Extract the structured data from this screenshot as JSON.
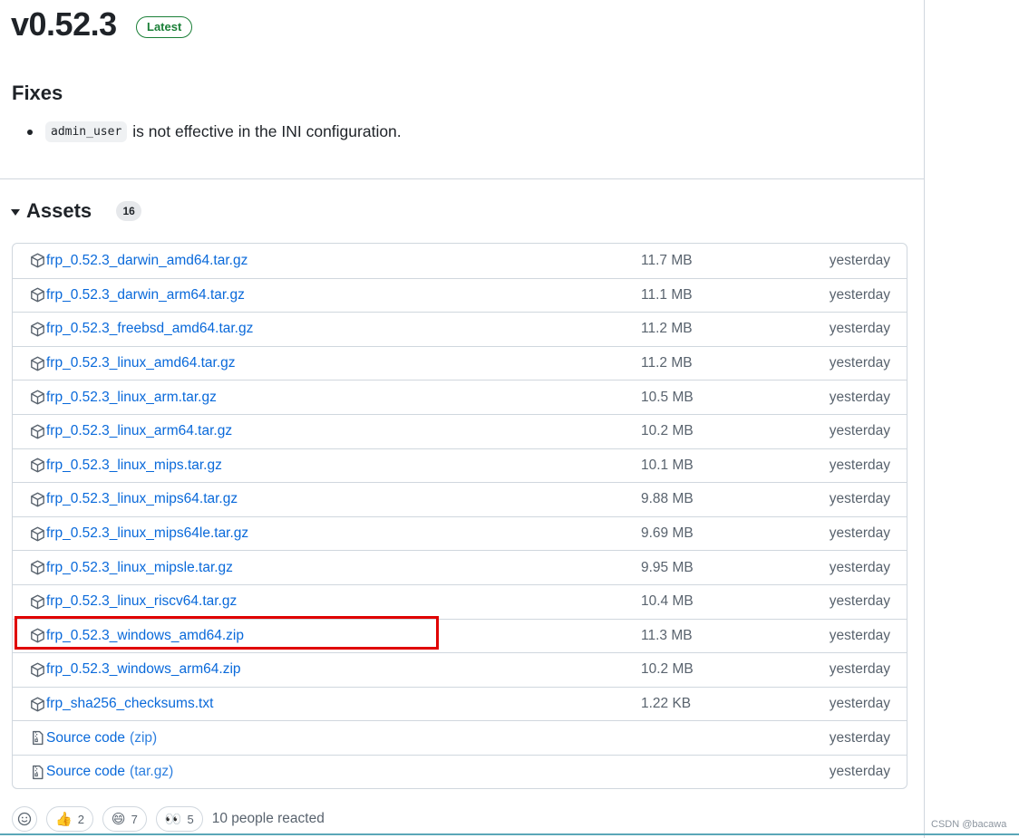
{
  "release": {
    "version": "v0.52.3",
    "badge": "Latest",
    "fixes_heading": "Fixes",
    "fix_code": "admin_user",
    "fix_text": "is not effective in the INI configuration."
  },
  "assets": {
    "title": "Assets",
    "count": "16",
    "rows": [
      {
        "name": "frp_0.52.3_darwin_amd64.tar.gz",
        "suffix": "",
        "size": "11.7 MB",
        "date": "yesterday",
        "icon": "package-icon"
      },
      {
        "name": "frp_0.52.3_darwin_arm64.tar.gz",
        "suffix": "",
        "size": "11.1 MB",
        "date": "yesterday",
        "icon": "package-icon"
      },
      {
        "name": "frp_0.52.3_freebsd_amd64.tar.gz",
        "suffix": "",
        "size": "11.2 MB",
        "date": "yesterday",
        "icon": "package-icon"
      },
      {
        "name": "frp_0.52.3_linux_amd64.tar.gz",
        "suffix": "",
        "size": "11.2 MB",
        "date": "yesterday",
        "icon": "package-icon"
      },
      {
        "name": "frp_0.52.3_linux_arm.tar.gz",
        "suffix": "",
        "size": "10.5 MB",
        "date": "yesterday",
        "icon": "package-icon"
      },
      {
        "name": "frp_0.52.3_linux_arm64.tar.gz",
        "suffix": "",
        "size": "10.2 MB",
        "date": "yesterday",
        "icon": "package-icon"
      },
      {
        "name": "frp_0.52.3_linux_mips.tar.gz",
        "suffix": "",
        "size": "10.1 MB",
        "date": "yesterday",
        "icon": "package-icon"
      },
      {
        "name": "frp_0.52.3_linux_mips64.tar.gz",
        "suffix": "",
        "size": "9.88 MB",
        "date": "yesterday",
        "icon": "package-icon"
      },
      {
        "name": "frp_0.52.3_linux_mips64le.tar.gz",
        "suffix": "",
        "size": "9.69 MB",
        "date": "yesterday",
        "icon": "package-icon"
      },
      {
        "name": "frp_0.52.3_linux_mipsle.tar.gz",
        "suffix": "",
        "size": "9.95 MB",
        "date": "yesterday",
        "icon": "package-icon"
      },
      {
        "name": "frp_0.52.3_linux_riscv64.tar.gz",
        "suffix": "",
        "size": "10.4 MB",
        "date": "yesterday",
        "icon": "package-icon"
      },
      {
        "name": "frp_0.52.3_windows_amd64.zip",
        "suffix": "",
        "size": "11.3 MB",
        "date": "yesterday",
        "icon": "package-icon"
      },
      {
        "name": "frp_0.52.3_windows_arm64.zip",
        "suffix": "",
        "size": "10.2 MB",
        "date": "yesterday",
        "icon": "package-icon"
      },
      {
        "name": "frp_sha256_checksums.txt",
        "suffix": "",
        "size": "1.22 KB",
        "date": "yesterday",
        "icon": "package-icon"
      },
      {
        "name": "Source code",
        "suffix": "(zip)",
        "size": "",
        "date": "yesterday",
        "icon": "file-zip-icon"
      },
      {
        "name": "Source code",
        "suffix": "(tar.gz)",
        "size": "",
        "date": "yesterday",
        "icon": "file-zip-icon"
      }
    ]
  },
  "reactions": {
    "items": [
      {
        "emoji": "👍",
        "count": "2",
        "icon": "thumbs-up-icon"
      },
      {
        "emoji": "😄",
        "count": "7",
        "icon": "laugh-icon"
      },
      {
        "emoji": "👀",
        "count": "5",
        "icon": "eyes-icon"
      }
    ],
    "summary": "10 people reacted"
  },
  "watermark": "CSDN @bacawa",
  "colors": {
    "link": "#0969da",
    "badge_green": "#1a7f37",
    "highlight_red": "#e00000"
  }
}
